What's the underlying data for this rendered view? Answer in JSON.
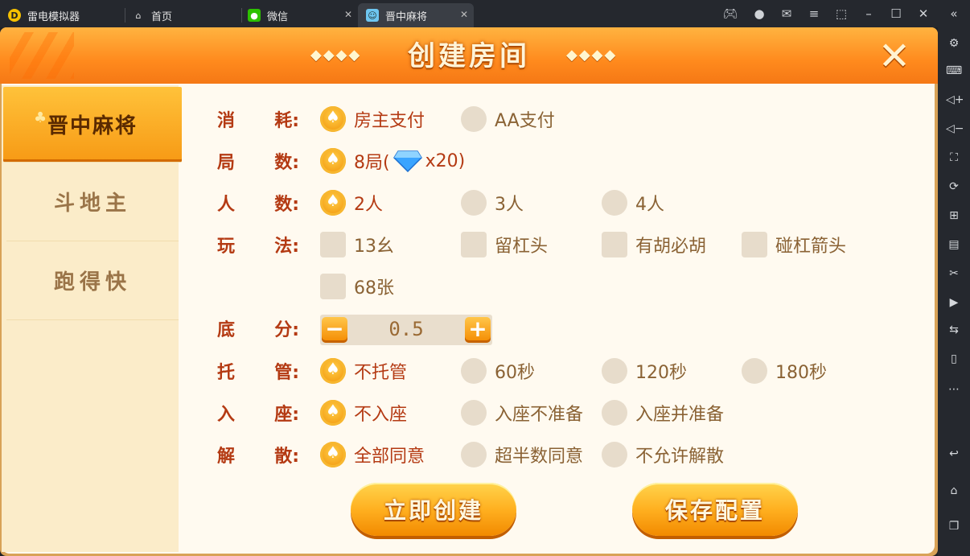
{
  "window": {
    "tabs": [
      {
        "label": "雷电模拟器",
        "icon": "ld-logo-icon"
      },
      {
        "label": "首页",
        "icon": "home-icon"
      },
      {
        "label": "微信",
        "icon": "wechat-icon"
      },
      {
        "label": "晋中麻将",
        "icon": "game-icon",
        "active": true
      }
    ]
  },
  "dialog": {
    "title": "创建房间",
    "deco": "◆◆◆◆"
  },
  "sidebar": {
    "items": [
      {
        "label": "晋中麻将",
        "active": true
      },
      {
        "label": "斗地主"
      },
      {
        "label": "跑得快"
      }
    ]
  },
  "form": {
    "cost": {
      "label": [
        "消",
        "耗:"
      ],
      "options": [
        "房主支付",
        "AA支付"
      ],
      "selected": 0
    },
    "rounds": {
      "label": [
        "局",
        "数:"
      ],
      "option": "8局(",
      "gem_count": "x20)"
    },
    "players": {
      "label": [
        "人",
        "数:"
      ],
      "options": [
        "2人",
        "3人",
        "4人"
      ],
      "selected": 0
    },
    "rules": {
      "label": [
        "玩",
        "法:"
      ],
      "options": [
        "13幺",
        "留杠头",
        "有胡必胡",
        "碰杠箭头",
        "68张"
      ]
    },
    "base": {
      "label": [
        "底",
        "分:"
      ],
      "value": "0.5",
      "minus": "−",
      "plus": "+"
    },
    "auto": {
      "label": [
        "托",
        "管:"
      ],
      "options": [
        "不托管",
        "60秒",
        "120秒",
        "180秒"
      ],
      "selected": 0
    },
    "seat": {
      "label": [
        "入",
        "座:"
      ],
      "options": [
        "不入座",
        "入座不准备",
        "入座并准备"
      ],
      "selected": 0
    },
    "dissolve": {
      "label": [
        "解",
        "散:"
      ],
      "options": [
        "全部同意",
        "超半数同意",
        "不允许解散"
      ],
      "selected": 0
    }
  },
  "buttons": {
    "create": "立即创建",
    "save": "保存配置"
  }
}
